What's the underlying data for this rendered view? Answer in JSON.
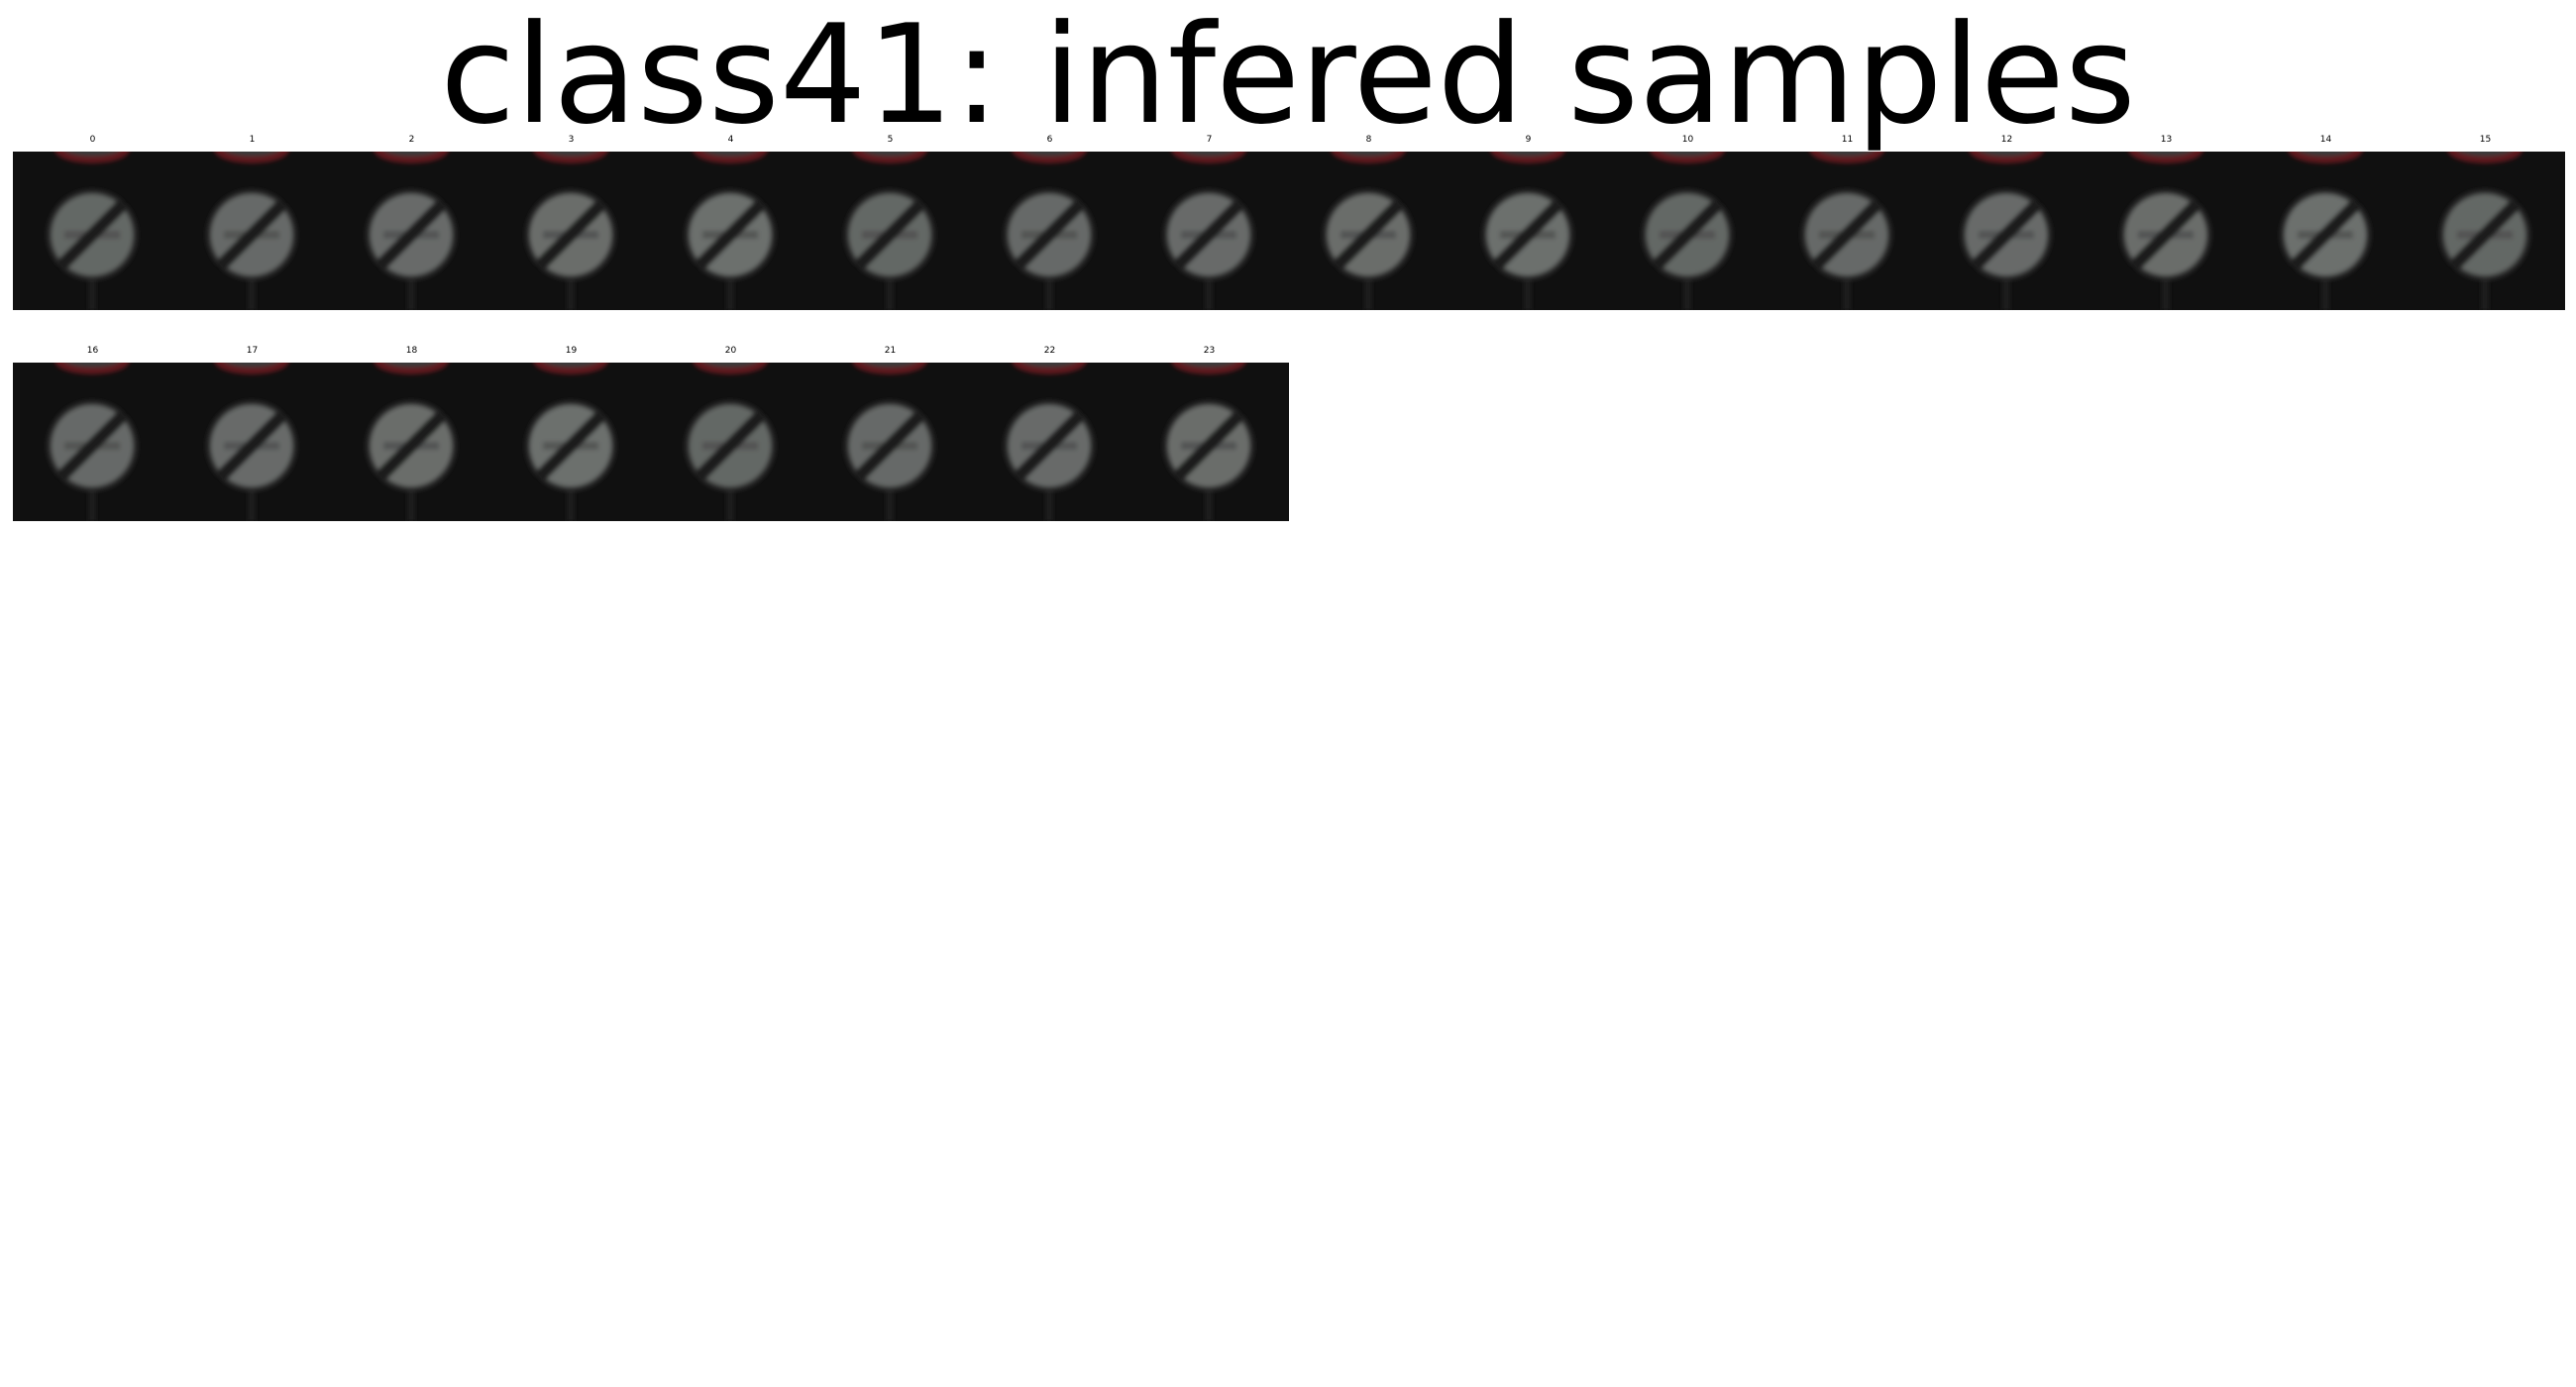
{
  "title": "class41: infered samples",
  "samples": [
    {
      "label": "0"
    },
    {
      "label": "1"
    },
    {
      "label": "2"
    },
    {
      "label": "3"
    },
    {
      "label": "4"
    },
    {
      "label": "5"
    },
    {
      "label": "6"
    },
    {
      "label": "7"
    },
    {
      "label": "8"
    },
    {
      "label": "9"
    },
    {
      "label": "10"
    },
    {
      "label": "11"
    },
    {
      "label": "12"
    },
    {
      "label": "13"
    },
    {
      "label": "14"
    },
    {
      "label": "15"
    },
    {
      "label": "16"
    },
    {
      "label": "17"
    },
    {
      "label": "18"
    },
    {
      "label": "19"
    },
    {
      "label": "20"
    },
    {
      "label": "21"
    },
    {
      "label": "22"
    },
    {
      "label": "23"
    }
  ],
  "image_description_colors": {
    "background": "#101010",
    "sign_face": "#6e7270",
    "sign_border": "#2a2a2a",
    "diagonal_band": "#1e1e1e",
    "top_sign_red": "#7a1e22"
  },
  "sign_icon": "end-of-no-overtaking-sign-icon"
}
